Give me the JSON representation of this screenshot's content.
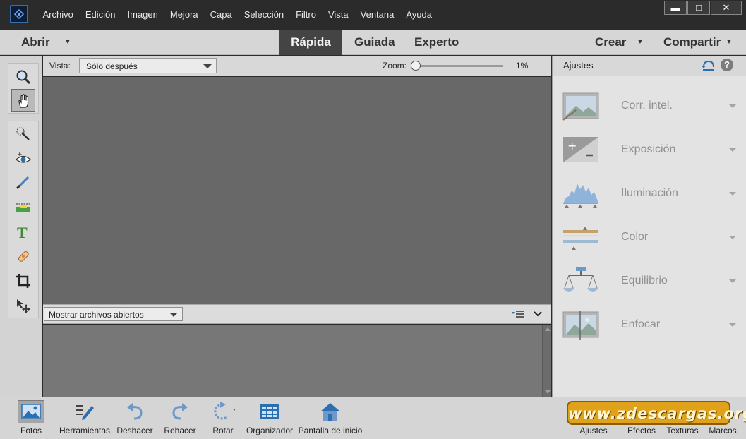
{
  "menu": {
    "items": [
      "Archivo",
      "Edición",
      "Imagen",
      "Mejora",
      "Capa",
      "Selección",
      "Filtro",
      "Vista",
      "Ventana",
      "Ayuda"
    ]
  },
  "window_controls": {
    "minimize": "▬",
    "maximize": "□",
    "close": "✕"
  },
  "modebar": {
    "open_label": "Abrir",
    "tabs": [
      "Rápida",
      "Guiada",
      "Experto"
    ],
    "active_tab": "Rápida",
    "create_label": "Crear",
    "share_label": "Compartir"
  },
  "view_bar": {
    "view_label": "Vista:",
    "view_value": "Sólo después",
    "zoom_label": "Zoom:",
    "zoom_value": "1%"
  },
  "bin_bar": {
    "select_value": "Mostrar archivos abiertos"
  },
  "tools": [
    "zoom",
    "hand",
    "quick-selection",
    "red-eye",
    "whiten-teeth",
    "straighten",
    "text",
    "spot-healing",
    "crop",
    "move"
  ],
  "active_tool": "hand",
  "adjustments": {
    "title": "Ajustes",
    "items": [
      {
        "label": "Corr. intel.",
        "icon": "smart-fix-icon"
      },
      {
        "label": "Exposición",
        "icon": "exposure-icon"
      },
      {
        "label": "Iluminación",
        "icon": "lighting-icon"
      },
      {
        "label": "Color",
        "icon": "color-icon"
      },
      {
        "label": "Equilibrio",
        "icon": "balance-icon"
      },
      {
        "label": "Enfocar",
        "icon": "sharpen-icon"
      }
    ]
  },
  "taskbar": {
    "left": [
      {
        "label": "Fotos",
        "icon": "photos-icon"
      },
      {
        "label": "Herramientas",
        "icon": "tools-icon"
      },
      {
        "label": "Deshacer",
        "icon": "undo-icon"
      },
      {
        "label": "Rehacer",
        "icon": "redo-icon"
      },
      {
        "label": "Rotar",
        "icon": "rotate-icon"
      },
      {
        "label": "Organizador",
        "icon": "organizer-icon"
      },
      {
        "label": "Pantalla de inicio",
        "icon": "home-icon"
      }
    ],
    "right": [
      {
        "label": "Ajustes"
      },
      {
        "label": "Efectos"
      },
      {
        "label": "Texturas"
      },
      {
        "label": "Marcos"
      }
    ]
  },
  "watermark": "www.zdescargas.org",
  "colors": {
    "titlebar": "#2b2b2b",
    "canvas": "#686868",
    "active_tab": "#444444",
    "panel": "#e3e3e3",
    "watermark_bg": "#e0a21b"
  }
}
